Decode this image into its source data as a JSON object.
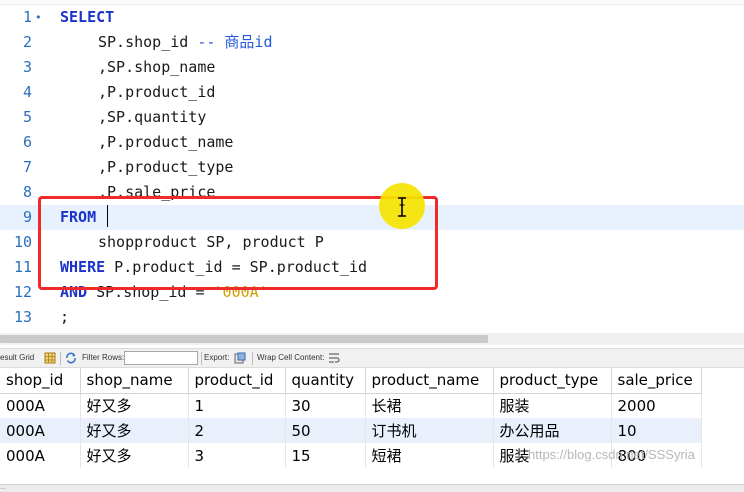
{
  "editor": {
    "lines": [
      {
        "num": "1",
        "parts": [
          {
            "t": "SELECT",
            "k": "kw"
          }
        ]
      },
      {
        "num": "2",
        "parts": [
          {
            "t": "SP.shop_id ",
            "k": ""
          },
          {
            "t": "-- 商品id",
            "k": "cmt"
          }
        ]
      },
      {
        "num": "3",
        "parts": [
          {
            "t": ",SP.shop_name",
            "k": ""
          }
        ]
      },
      {
        "num": "4",
        "parts": [
          {
            "t": ",P.product_id",
            "k": ""
          }
        ]
      },
      {
        "num": "5",
        "parts": [
          {
            "t": ",SP.quantity",
            "k": ""
          }
        ]
      },
      {
        "num": "6",
        "parts": [
          {
            "t": ",P.product_name",
            "k": ""
          }
        ]
      },
      {
        "num": "7",
        "parts": [
          {
            "t": ",P.product_type",
            "k": ""
          }
        ]
      },
      {
        "num": "8",
        "parts": [
          {
            "t": ",P.sale_price",
            "k": ""
          }
        ]
      },
      {
        "num": "9",
        "parts": [
          {
            "t": "FROM",
            "k": "kw"
          }
        ]
      },
      {
        "num": "10",
        "parts": [
          {
            "t": "shopproduct SP, product P",
            "k": ""
          }
        ]
      },
      {
        "num": "11",
        "parts": [
          {
            "t": "WHERE",
            "k": "kw"
          },
          {
            "t": " P.product_id = SP.product_id",
            "k": ""
          }
        ]
      },
      {
        "num": "12",
        "parts": [
          {
            "t": "AND",
            "k": "kw"
          },
          {
            "t": " SP.shop_id = ",
            "k": ""
          },
          {
            "t": "'000A'",
            "k": "str"
          }
        ]
      },
      {
        "num": "13",
        "parts": [
          {
            "t": ";",
            "k": ""
          }
        ]
      }
    ],
    "fold_marker": "•"
  },
  "toolbar": {
    "result_grid_label": "esult Grid",
    "filter_rows_label": "Filter Rows:",
    "filter_rows_value": "",
    "export_label": "Export:",
    "wrap_label": "Wrap Cell Content:"
  },
  "grid": {
    "columns": [
      "shop_id",
      "shop_name",
      "product_id",
      "quantity",
      "product_name",
      "product_type",
      "sale_price"
    ],
    "rows": [
      [
        "000A",
        "好又多",
        "1",
        "30",
        "长裙",
        "服装",
        "2000"
      ],
      [
        "000A",
        "好又多",
        "2",
        "50",
        "订书机",
        "办公用品",
        "10"
      ],
      [
        "000A",
        "好又多",
        "3",
        "15",
        "短裙",
        "服装",
        "800"
      ]
    ]
  },
  "watermark": "https://blog.csdn.net/SSSyria",
  "bottom_label": "..."
}
